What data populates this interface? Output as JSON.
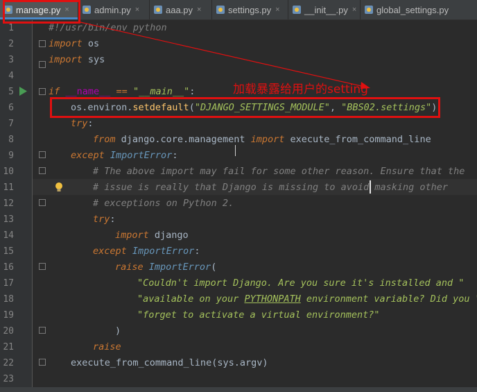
{
  "tabs": [
    {
      "label": "manage.py",
      "active": true
    },
    {
      "label": "admin.py",
      "active": false
    },
    {
      "label": "aaa.py",
      "active": false
    },
    {
      "label": "settings.py",
      "active": false
    },
    {
      "label": "__init__.py",
      "active": false
    },
    {
      "label": "global_settings.py",
      "active": false
    }
  ],
  "tab_close_glyph": "×",
  "line_numbers": [
    "1",
    "2",
    "3",
    "4",
    "5",
    "6",
    "7",
    "8",
    "9",
    "10",
    "11",
    "12",
    "13",
    "14",
    "15",
    "16",
    "17",
    "18",
    "19",
    "20",
    "21",
    "22",
    "23"
  ],
  "code": {
    "l1": "#!/usr/bin/env python",
    "l2_kw": "import",
    "l2_rest": " os",
    "l3_kw": "import",
    "l3_rest": " sys",
    "l5_kw": "if",
    "l5_a": " __name__ ",
    "l5_op": "==",
    "l5_str": " \"__main__\"",
    "l5_colon": ":",
    "l6_a": "os.environ.",
    "l6_fn": "setdefault",
    "l6_b": "(",
    "l6_s1": "\"DJANGO_SETTINGS_MODULE\"",
    "l6_c": ", ",
    "l6_s2": "\"BBS02.settings\"",
    "l6_d": ")",
    "l7_kw": "try",
    "l7_c": ":",
    "l8_kw": "from",
    "l8_a": " django.core.management ",
    "l8_kw2": "import",
    "l8_b": " execute_from_command_line",
    "l9_kw": "except",
    "l9_cls": " ImportError",
    "l9_c": ":",
    "l10": "# The above import may fail for some other reason. Ensure that the",
    "l11": "# issue is really that Django is missing to avoid masking other",
    "l12": "# exceptions on Python 2.",
    "l13_kw": "try",
    "l13_c": ":",
    "l14_kw": "import",
    "l14_rest": " django",
    "l15_kw": "except",
    "l15_cls": " ImportError",
    "l15_c": ":",
    "l16_kw": "raise",
    "l16_cls": " ImportError",
    "l16_c": "(",
    "l17": "\"Couldn't import Django. Are you sure it's installed and \"",
    "l18_a": "\"available on your ",
    "l18_u": "PYTHONPATH",
    "l18_b": " environment variable? Did you \"",
    "l19": "\"forget to activate a virtual environment?\"",
    "l20": ")",
    "l21_kw": "raise",
    "l22": "execute_from_command_line(sys.argv)"
  },
  "annotation": "加载暴露给用户的setting",
  "colors": {
    "annotation": "#e01010",
    "background": "#2b2b2b",
    "keyword": "#cc7832",
    "string": "#a5c25c",
    "comment": "#808080"
  }
}
